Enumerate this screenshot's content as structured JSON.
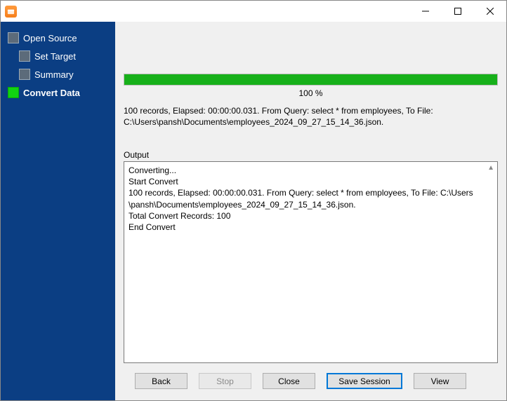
{
  "window": {
    "title": ""
  },
  "sidebar": {
    "items": [
      {
        "label": "Open Source"
      },
      {
        "label": "Set Target"
      },
      {
        "label": "Summary"
      },
      {
        "label": "Convert Data"
      }
    ]
  },
  "progress": {
    "percent_text": "100 %"
  },
  "summary_line1": "100 records,    Elapsed: 00:00:00.031.    From Query: select * from employees,    To File:",
  "summary_line2": "C:\\Users\\pansh\\Documents\\employees_2024_09_27_15_14_36.json.",
  "output": {
    "label": "Output",
    "lines": {
      "l1": "Converting...",
      "l2": "Start Convert",
      "l3": "100 records,    Elapsed: 00:00:00.031.    From Query: select * from employees,    To File: C:\\Users",
      "l4": "\\pansh\\Documents\\employees_2024_09_27_15_14_36.json.",
      "l5": "Total Convert Records: 100",
      "l6": "End Convert"
    }
  },
  "buttons": {
    "back": "Back",
    "stop": "Stop",
    "close": "Close",
    "save_session": "Save Session",
    "view": "View"
  }
}
